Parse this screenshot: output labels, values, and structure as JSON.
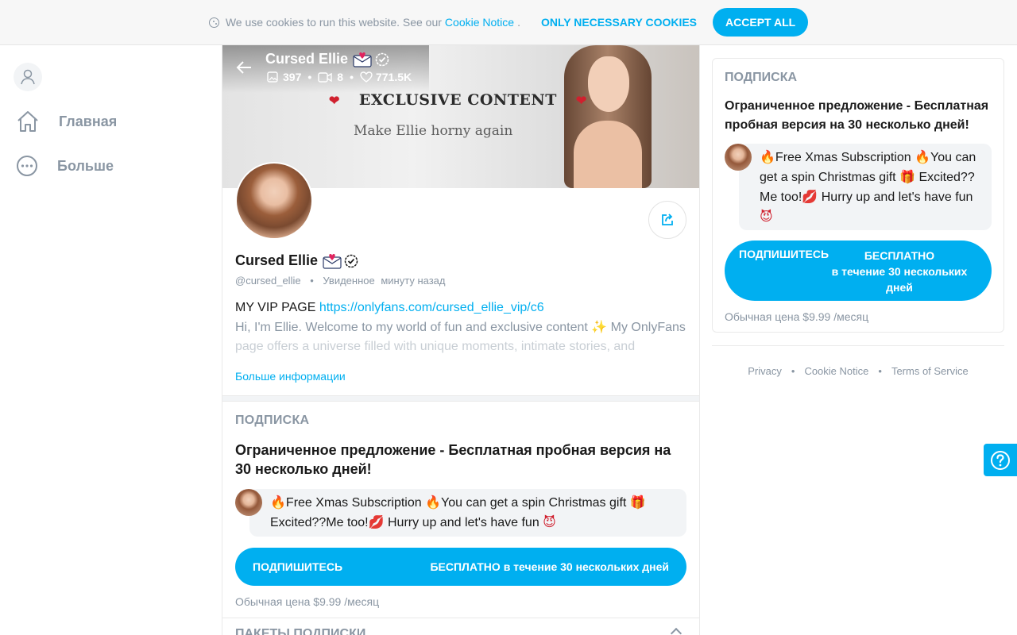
{
  "cookie_bar": {
    "text": "We use cookies to run this website. See our",
    "link": "Cookie Notice",
    "after": ".",
    "necessary_label": "ONLY NECESSARY COOKIES",
    "accept_label": "ACCEPT ALL"
  },
  "sidebar": {
    "items": [
      {
        "label": "Главная",
        "icon": "home-icon"
      },
      {
        "label": "Больше",
        "icon": "more-icon"
      }
    ]
  },
  "banner": {
    "title": "Cursed Ellie",
    "stats": {
      "photos": "397",
      "videos": "8",
      "likes": "771.5K"
    },
    "exclusive": "EXCLUSIVE CONTENT",
    "heart": "❤",
    "tagline": "Make Ellie horny again"
  },
  "profile": {
    "name": "Cursed Ellie",
    "handle": "@cursed_ellie",
    "seen_label": "Увиденное",
    "seen_time": "минуту назад",
    "bio_prefix": "MY VIP PAGE",
    "bio_link": "https://onlyfans.com/cursed_ellie_vip/c6",
    "bio_line2": "Hi, I'm Ellie. Welcome to my world of fun and exclusive content",
    "bio_line2b": "My OnlyFans",
    "bio_line3": "page offers a universe filled with unique moments, intimate stories, and",
    "more_info": "Больше информации"
  },
  "subscription": {
    "label": "ПОДПИСКА",
    "offer": "Ограниченное предложение - Бесплатная пробная версия на 30 несколько дней!",
    "promo_a": "Free Xmas Subscription",
    "promo_b": "You can get a spin Christmas gift",
    "promo_c": "Excited??Me too!",
    "promo_d": "Hurry up and let's have fun",
    "btn_left": "ПОДПИШИТЕСЬ",
    "btn_right": "БЕСПЛАТНО в течение 30 нескольких дней",
    "regular_price": "Обычная цена $9.99 /месяц",
    "packets_label": "ПАКЕТЫ ПОДПИСКИ"
  },
  "right_card": {
    "label": "ПОДПИСКА",
    "offer": "Ограниченное предложение - Бесплатная пробная версия на 30 несколько дней!",
    "promo_a": "Free Xmas Subscription",
    "promo_b": "You can get a spin Christmas gift",
    "promo_c": "Excited?? Me too!",
    "promo_d": "Hurry up and let's have fun",
    "btn_left": "ПОДПИШИТЕСЬ",
    "btn_right_1": "БЕСПЛАТНО",
    "btn_right_2": "в течение 30 нескольких дней",
    "regular_price": "Обычная цена $9.99 /месяц"
  },
  "footer": {
    "links": [
      "Privacy",
      "Cookie Notice",
      "Terms of Service"
    ]
  },
  "colors": {
    "accent": "#00aff0",
    "muted": "#8a96a3"
  }
}
